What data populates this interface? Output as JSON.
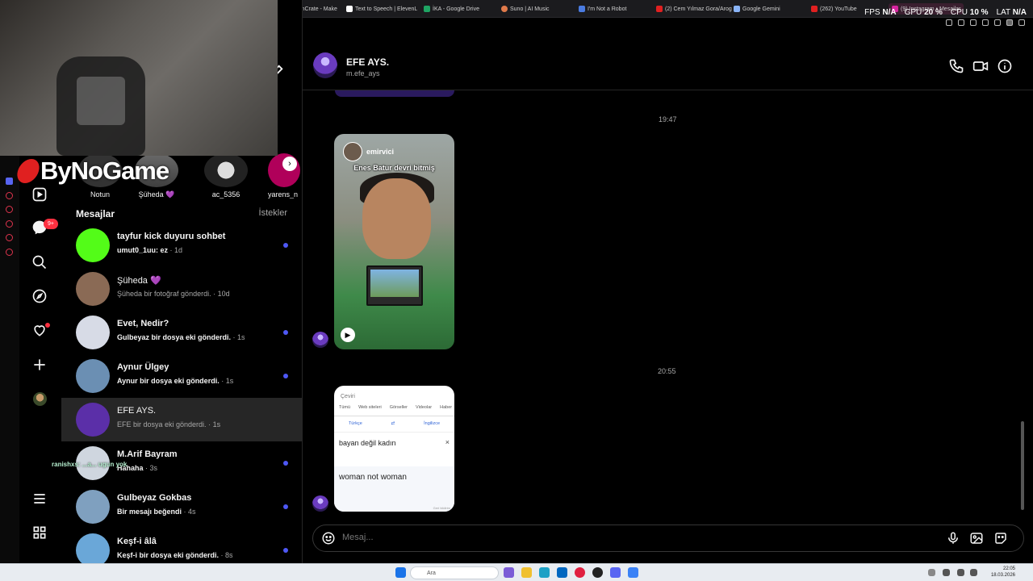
{
  "browser": {
    "tabs": [
      {
        "label": "ProductionCrate - Make",
        "color": "#333333"
      },
      {
        "label": "Text to Speech | ElevenL",
        "color": "#ffffff"
      },
      {
        "label": "İKA - Google Drive",
        "color": "#1fa463"
      },
      {
        "label": "Suno | AI Music",
        "color": "#e07a4a"
      },
      {
        "label": "I'm Not a Robot",
        "color": "#4a7be0"
      },
      {
        "label": "(2) Cem Yılmaz Gora/Arog",
        "color": "#e02020"
      },
      {
        "label": "Google Gemini",
        "color": "#8ab4f8"
      },
      {
        "label": "(262) YouTube",
        "color": "#e02020"
      },
      {
        "label": "(9) Instagram • Mesajlar",
        "color": "#d6249f"
      }
    ],
    "stats": {
      "fps_label": "FPS",
      "fps_value": "N/A",
      "gpu_label": "GPU",
      "gpu_value": "20 %",
      "cpu_label": "CPU",
      "cpu_value": "10 %",
      "lat_label": "LAT",
      "lat_value": "N/A"
    }
  },
  "overlay": {
    "logo_text": "ByNoGame",
    "chat_text": "ranishxs: ...a... ugun yok"
  },
  "nav": {
    "notifications_badge": "9+"
  },
  "stories": [
    {
      "name": "Notun"
    },
    {
      "name": "Şüheda 💜"
    },
    {
      "name": "ac_5356"
    },
    {
      "name": "yarens_n"
    }
  ],
  "messages_panel": {
    "header": "Mesajlar",
    "requests": "İstekler",
    "conversations": [
      {
        "name": "tayfur kick duyuru sohbet",
        "preview": "umut0_1uu: ez",
        "time": "1d",
        "unread": true,
        "avatar_color": "#53fc18"
      },
      {
        "name": "Şüheda 💜",
        "preview": "Şüheda bir fotoğraf gönderdi.",
        "time": "10d",
        "unread": false,
        "avatar_color": "#8a6a55"
      },
      {
        "name": "Evet, Nedir?",
        "preview": "Gulbeyaz bir dosya eki gönderdi.",
        "time": "1s",
        "unread": true,
        "avatar_color": "#d7dbe6"
      },
      {
        "name": "Aynur Ülgey",
        "preview": "Aynur bir dosya eki gönderdi.",
        "time": "1s",
        "unread": true,
        "avatar_color": "#6b8fb3"
      },
      {
        "name": "EFE AYS.",
        "preview": "EFE bir dosya eki gönderdi.",
        "time": "1s",
        "unread": false,
        "avatar_color": "#5b2fa8"
      },
      {
        "name": "M.Arif Bayram",
        "preview": "Hahaha",
        "time": "3s",
        "unread": true,
        "avatar_color": "#cfd6df"
      },
      {
        "name": "Gulbeyaz Gokbas",
        "preview": "Bir mesajı beğendi",
        "time": "4s",
        "unread": true,
        "avatar_color": "#7fa0bf"
      },
      {
        "name": "Keşf-i âlâ",
        "preview": "Keşf-i bir dosya eki gönderdi.",
        "time": "8s",
        "unread": true,
        "avatar_color": "#6aa7d8"
      }
    ]
  },
  "chat": {
    "name": "EFE AYS.",
    "username": "m.efe_ays",
    "timestamp1": "19:47",
    "timestamp2": "20:55",
    "reel": {
      "user": "emirvici",
      "caption": "Enes Batur devri bitmiş"
    },
    "translate_card": {
      "search_text": "Çeviri",
      "tabs": [
        "Tümü",
        "Web siteleri",
        "Görseller",
        "Videolar",
        "Haber"
      ],
      "source_lang": "Türkçe",
      "target_lang": "İngilizce",
      "source_text": "bayan değil kadın",
      "target_text": "woman not woman",
      "footer": "Geri bildirim"
    },
    "composer_placeholder": "Mesaj..."
  },
  "taskbar": {
    "search_placeholder": "Ara",
    "time": "22:05",
    "date": "18.03.2026"
  }
}
